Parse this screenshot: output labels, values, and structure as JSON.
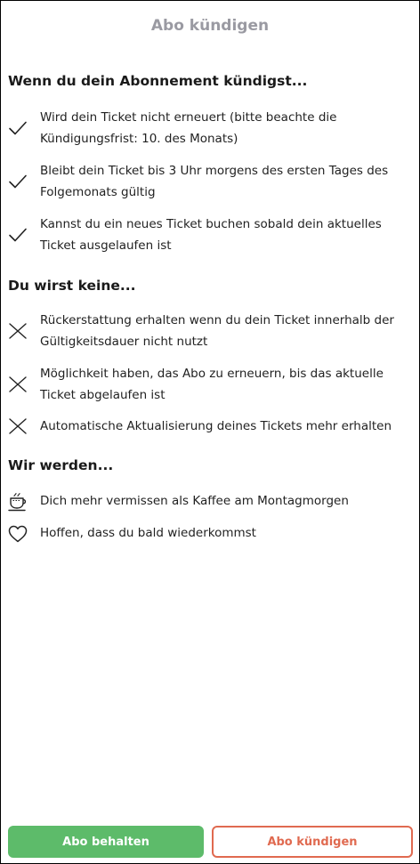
{
  "header": {
    "title": "Abo kündigen"
  },
  "sections": {
    "when_cancel": {
      "title": "Wenn du dein Abonnement kündigst...",
      "items": [
        {
          "icon": "checkmark-icon",
          "text": "Wird dein Ticket nicht erneuert (bitte beachte die Kündigungsfrist: 10. des Monats)"
        },
        {
          "icon": "checkmark-icon",
          "text": "Bleibt dein Ticket bis 3 Uhr morgens des ersten Tages des Folgemonats gültig"
        },
        {
          "icon": "checkmark-icon",
          "text": "Kannst du ein neues Ticket buchen sobald dein aktuelles Ticket ausgelaufen ist"
        }
      ]
    },
    "you_wont": {
      "title": "Du wirst keine...",
      "items": [
        {
          "icon": "cross-icon",
          "text": "Rückerstattung erhalten wenn du dein Ticket innerhalb der Gültigkeitsdauer nicht nutzt"
        },
        {
          "icon": "cross-icon",
          "text": "Möglichkeit haben, das Abo zu erneuern, bis das aktuelle Ticket abgelaufen ist"
        },
        {
          "icon": "cross-icon",
          "text": "Automatische Aktualisierung deines Tickets mehr erhalten"
        }
      ]
    },
    "we_will": {
      "title": "Wir werden...",
      "items": [
        {
          "icon": "coffee-cup-icon",
          "text": "Dich mehr vermissen als Kaffee am Montagmorgen"
        },
        {
          "icon": "heart-icon",
          "text": "Hoffen, dass du bald wiederkommst"
        }
      ]
    }
  },
  "buttons": {
    "keep_label": "Abo behalten",
    "cancel_label": "Abo kündigen"
  },
  "colors": {
    "keep_button": "#5dbb6a",
    "cancel_button": "#e06a50",
    "title": "#9a9aa2"
  }
}
